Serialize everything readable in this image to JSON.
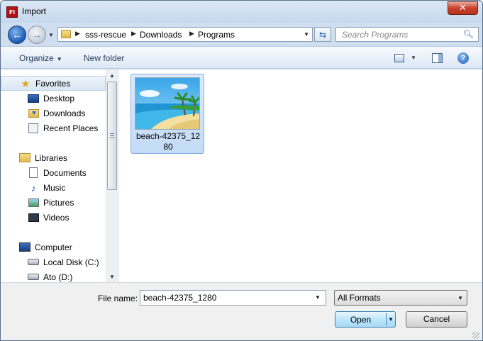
{
  "window": {
    "title": "Import",
    "app_icon_text": "Fl",
    "close_glyph": "✕"
  },
  "nav": {
    "back_glyph": "←",
    "forward_glyph": "→",
    "breadcrumb": [
      "sss-rescue",
      "Downloads",
      "Programs"
    ],
    "search_placeholder": "Search Programs"
  },
  "toolbar": {
    "organize_label": "Organize",
    "new_folder_label": "New folder",
    "help_glyph": "?"
  },
  "sidebar": {
    "favorites": {
      "label": "Favorites",
      "icon": "star-icon"
    },
    "favorites_items": [
      {
        "label": "Desktop",
        "icon": "desktop-icon"
      },
      {
        "label": "Downloads",
        "icon": "downloads-folder-icon"
      },
      {
        "label": "Recent Places",
        "icon": "recent-places-icon"
      }
    ],
    "libraries": {
      "label": "Libraries",
      "icon": "libraries-icon"
    },
    "libraries_items": [
      {
        "label": "Documents",
        "icon": "documents-icon"
      },
      {
        "label": "Music",
        "icon": "music-icon"
      },
      {
        "label": "Pictures",
        "icon": "pictures-icon"
      },
      {
        "label": "Videos",
        "icon": "videos-icon"
      }
    ],
    "computer": {
      "label": "Computer",
      "icon": "computer-icon"
    },
    "computer_items": [
      {
        "label": "Local Disk (C:)",
        "icon": "disk-icon"
      },
      {
        "label": "Ato (D:)",
        "icon": "disk-icon"
      }
    ]
  },
  "files": [
    {
      "name": "beach-42375_1280",
      "selected": true
    }
  ],
  "bottom": {
    "file_name_label": "File name:",
    "file_name_value": "beach-42375_1280",
    "format_value": "All Formats",
    "open_label": "Open",
    "cancel_label": "Cancel"
  },
  "colors": {
    "accent": "#3c7fb1",
    "selection": "#c3dbf6",
    "close": "#c7402a"
  }
}
